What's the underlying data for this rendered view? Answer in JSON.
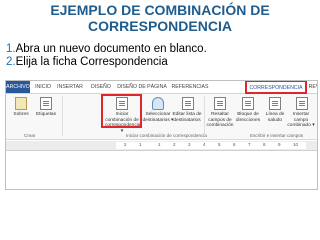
{
  "slide": {
    "title_line1": "EJEMPLO DE COMBINACIÓN DE",
    "title_line2": "CORRESPONDENCIA",
    "steps": [
      {
        "num": "1.",
        "text": "Abra un nuevo documento en blanco."
      },
      {
        "num": "2.",
        "text": "Elija la ficha Correspondencia"
      }
    ]
  },
  "ribbon": {
    "tabs": [
      "ARCHIVO",
      "INICIO",
      "INSERTAR",
      "DISEÑO",
      "DISEÑO DE PÁGINA",
      "REFERENCIAS",
      "CORRESPONDENCIA",
      "REV"
    ],
    "buttons": {
      "sobres": "Sobres",
      "etiquetas": "Etiquetas",
      "iniciar": "Iniciar combinación de correspondencia ▾",
      "seleccionar": "Seleccionar destinatarios ▾",
      "editar": "Editar lista de destinatarios",
      "resaltar": "Resaltar campos de combinación",
      "bloque": "Bloque de direcciones",
      "linea": "Línea de saludo",
      "insertar": "Insertar campo combinado ▾"
    },
    "groups": {
      "crear": "Crear",
      "iniciar": "Iniciar combinación de correspondencia",
      "escribir": "Escribir e insertar campos"
    },
    "ruler": [
      "2",
      "1",
      "1",
      "2",
      "3",
      "4",
      "5",
      "6",
      "7",
      "8",
      "9",
      "10"
    ]
  },
  "colors": {
    "title": "#1f5c8e",
    "file_tab": "#2b579a",
    "highlight": "#e0262a"
  }
}
